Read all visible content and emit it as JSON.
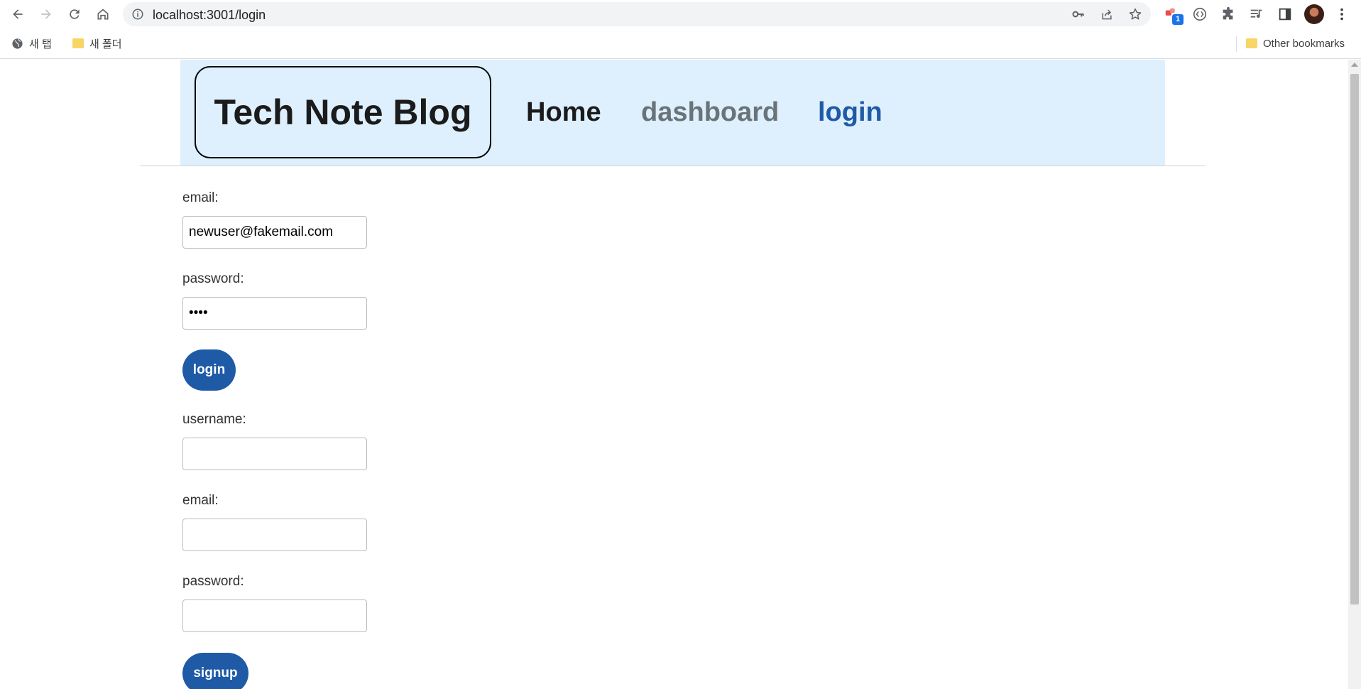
{
  "browser": {
    "url": "localhost:3001/login",
    "bookmarks": {
      "new_tab": "새 탭",
      "new_folder": "새 폴더",
      "other": "Other bookmarks"
    },
    "extension_badge": "1"
  },
  "site": {
    "brand": "Tech Note Blog",
    "nav": {
      "home": "Home",
      "dashboard": "dashboard",
      "login": "login"
    },
    "colors": {
      "header_bg": "#def0fd",
      "home": "#1b1b1b",
      "dashboard": "#6a7378",
      "login": "#1f5aa6",
      "button": "#1f5aa6"
    }
  },
  "login_form": {
    "email_label": "email:",
    "email_value": "newuser@fakemail.com",
    "password_label": "password:",
    "password_value": "pass",
    "submit_label": "login"
  },
  "signup_form": {
    "username_label": "username:",
    "username_value": "",
    "email_label": "email:",
    "email_value": "",
    "password_label": "password:",
    "password_value": "",
    "submit_label": "signup"
  }
}
